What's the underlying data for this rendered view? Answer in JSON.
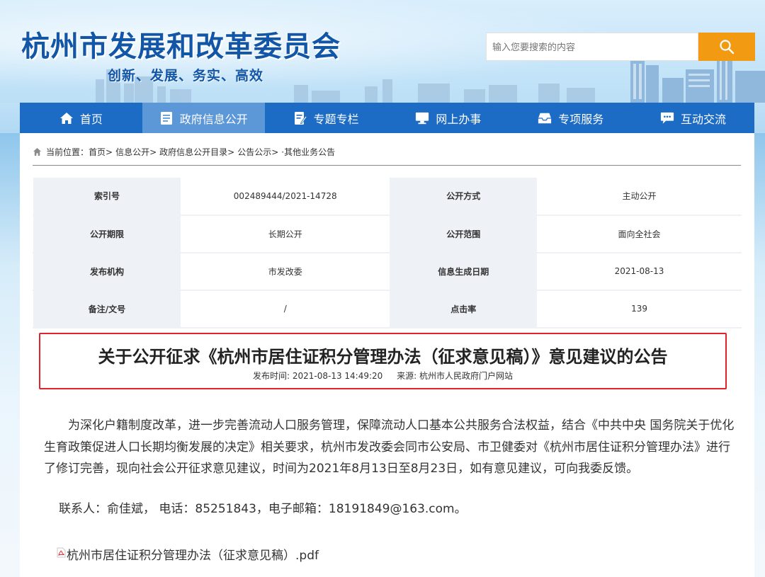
{
  "header": {
    "title": "杭州市发展和改革委员会",
    "slogan": "创新、发展、务实、高效",
    "search_placeholder": "输入您要搜索的内容"
  },
  "nav": [
    {
      "label": "首页",
      "icon": "home-icon"
    },
    {
      "label": "政府信息公开",
      "icon": "document-list-icon"
    },
    {
      "label": "专题专栏",
      "icon": "edit-icon"
    },
    {
      "label": "网上办事",
      "icon": "monitor-icon"
    },
    {
      "label": "专项服务",
      "icon": "inbox-icon"
    },
    {
      "label": "互动交流",
      "icon": "chat-icon"
    }
  ],
  "breadcrumb": {
    "prefix": "当前位置：",
    "items": [
      "首页>",
      "信息公开>",
      "政府信息公开目录>",
      "公告公示>",
      "·其他业务公告"
    ]
  },
  "info": [
    [
      "索引号",
      "002489444/2021-14728",
      "公开方式",
      "主动公开"
    ],
    [
      "公开期限",
      "长期公开",
      "公开范围",
      "面向全社会"
    ],
    [
      "发布机构",
      "市发改委",
      "信息生成日期",
      "2021-08-13"
    ],
    [
      "备注/文号",
      "/",
      "点击率",
      "139"
    ]
  ],
  "article": {
    "title": "关于公开征求《杭州市居住证积分管理办法（征求意见稿）》意见建议的公告",
    "publish_time": "发布时间: 2021-08-13 14:49:20",
    "source": "来源: 杭州市人民政府门户网站",
    "body": "为深化户籍制度改革，进一步完善流动人口服务管理，保障流动人口基本公共服务合法权益，结合《中共中央 国务院关于优化生育政策促进人口长期均衡发展的决定》相关要求，杭州市发改委会同市公安局、市卫健委对《杭州市居住证积分管理办法》进行了修订完善，现向社会公开征求意见建议，时间为2021年8月13日至8月23日，如有意见建议，可向我委反馈。",
    "contact": "联系人：俞佳斌， 电话：85251843，电子邮箱：18191849@163.com。",
    "attachment": "杭州市居住证积分管理办法（征求意见稿）.pdf"
  },
  "colors": {
    "nav_bg": "#1c6bc4",
    "nav_active": "#5c97d8",
    "title_blue": "#1256a8",
    "search_button": "#f29a11",
    "highlight_border": "#e0242b"
  }
}
